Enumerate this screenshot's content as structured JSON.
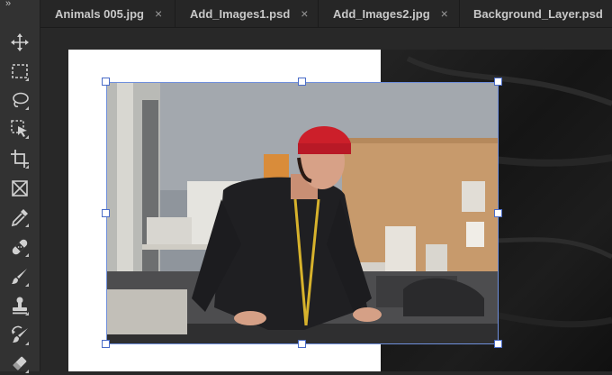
{
  "toolbar": {
    "collapse_glyph": "»",
    "tools": [
      {
        "name": "move-tool",
        "icon": "move-icon"
      },
      {
        "name": "marquee-tool",
        "icon": "rectangular-marquee-icon"
      },
      {
        "name": "lasso-tool",
        "icon": "lasso-icon"
      },
      {
        "name": "object-selection-tool",
        "icon": "object-selection-icon"
      },
      {
        "name": "crop-tool",
        "icon": "crop-icon"
      },
      {
        "name": "frame-tool",
        "icon": "frame-icon"
      },
      {
        "name": "eyedropper-tool",
        "icon": "eyedropper-icon"
      },
      {
        "name": "healing-brush-tool",
        "icon": "bandage-icon"
      },
      {
        "name": "brush-tool",
        "icon": "brush-icon"
      },
      {
        "name": "clone-stamp-tool",
        "icon": "stamp-icon"
      },
      {
        "name": "history-brush-tool",
        "icon": "history-brush-icon"
      },
      {
        "name": "eraser-tool",
        "icon": "eraser-icon"
      }
    ]
  },
  "tabs": [
    {
      "label": "Animals 005.jpg",
      "close": "×"
    },
    {
      "label": "Add_Images1.psd",
      "close": "×"
    },
    {
      "label": "Add_Images2.jpg",
      "close": "×"
    },
    {
      "label": "Background_Layer.psd",
      "close": ""
    }
  ],
  "canvas": {
    "selected_layer": "placed-photo",
    "transform_mode": "free-transform"
  },
  "colors": {
    "toolbar_bg": "#323232",
    "tab_bg": "#262626",
    "workspace_bg": "#282828",
    "bounding_box": "#6f8fdc"
  }
}
